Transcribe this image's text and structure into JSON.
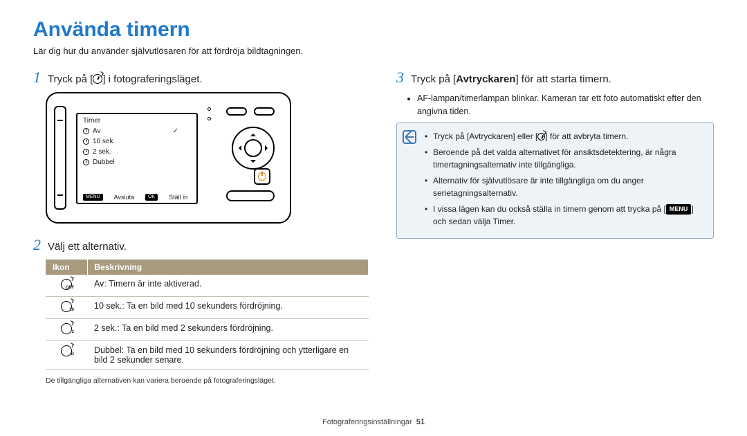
{
  "title": "Använda timern",
  "subtitle": "Lär dig hur du använder självutlösaren för att fördröja bildtagningen.",
  "left": {
    "step1": {
      "num": "1",
      "pre": "Tryck på [",
      "post": "] i fotograferingsläget."
    },
    "screen": {
      "title": "Timer",
      "opt_off": "Av",
      "opt_10": "10 sek.",
      "opt_2": "2 sek.",
      "opt_d": "Dubbel",
      "foot_left": "Avsluta",
      "foot_right": "Ställ in"
    },
    "step2": {
      "num": "2",
      "text": "Välj ett alternativ."
    },
    "table": {
      "h1": "Ikon",
      "h2": "Beskrivning",
      "r1b": "Av",
      "r1t": ": Timern är inte aktiverad.",
      "r2b": "10 sek.",
      "r2t": ": Ta en bild med 10 sekunders fördröjning.",
      "r3b": "2 sek.",
      "r3t": ": Ta en bild med 2 sekunders fördröjning.",
      "r4b": "Dubbel",
      "r4t": ": Ta en bild med 10 sekunders fördröjning och ytterligare en bild 2 sekunder senare."
    },
    "footnote": "De tillgängliga alternativen kan variera beroende på fotograferingsläget."
  },
  "right": {
    "step3": {
      "num": "3",
      "pre": "Tryck på [",
      "bold": "Avtryckaren",
      "post": "] för att starta timern."
    },
    "sub1": "AF-lampan/timerlampan blinkar. Kameran tar ett foto automatiskt efter den angivna tiden.",
    "info": {
      "li1a": "Tryck på [",
      "li1b": "Avtryckaren",
      "li1c": "] eller [",
      "li1d": "] för att avbryta timern.",
      "li2": "Beroende på det valda alternativet för ansiktsdetektering, är några timertagningsalternativ inte tillgängliga.",
      "li3": "Alternativ för självutlösare är inte tillgängliga om du anger serietagningsalternativ.",
      "li4a": "I vissa lägen kan du också ställa in timern genom att trycka på [",
      "li4menu": "MENU",
      "li4b": "] och sedan välja ",
      "li4bold": "Timer",
      "li4c": "."
    }
  },
  "pagefoot": {
    "section": "Fotograferingsinställningar",
    "num": "51"
  }
}
